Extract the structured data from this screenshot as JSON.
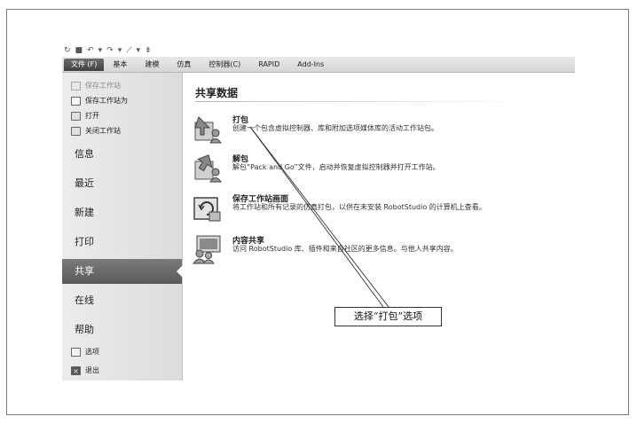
{
  "quick_access": {
    "items": [
      "↻",
      "■",
      "↶",
      "▾",
      "↷",
      "▾",
      "⟋",
      "▾",
      "⇟"
    ]
  },
  "ribbon": {
    "file_tab": "文件 (F)",
    "tabs": [
      "基本",
      "建模",
      "仿真",
      "控制器(C)",
      "RAPID",
      "Add-Ins"
    ]
  },
  "sidebar": {
    "small_top": [
      {
        "label": "保存工作站",
        "icon": "save-icon",
        "disabled": true
      },
      {
        "label": "保存工作站为",
        "icon": "save-as-icon",
        "disabled": false
      },
      {
        "label": "打开",
        "icon": "open-folder-icon",
        "disabled": false
      },
      {
        "label": "关闭工作站",
        "icon": "close-folder-icon",
        "disabled": false
      }
    ],
    "big_items": [
      "信息",
      "最近",
      "新建",
      "打印",
      "共享",
      "在线",
      "帮助"
    ],
    "active_item": "共享",
    "small_bottom": [
      {
        "label": "选项",
        "icon": "options-icon"
      },
      {
        "label": "退出",
        "icon": "exit-icon"
      }
    ]
  },
  "content": {
    "section_title": "共享数据",
    "commands": [
      {
        "title": "打包",
        "desc": "创建一个包含虚拟控制器、库和附加选项媒体库的活动工作站包。",
        "icon": "pack-icon"
      },
      {
        "title": "解包",
        "desc": "解包“Pack and Go”文件，启动并恢复虚拟控制器并打开工作站。",
        "icon": "unpack-icon"
      },
      {
        "title": "保存工作站画面",
        "desc": "将工作站和所有记录的仿真打包，以供在未安装 RobotStudio 的计算机上查看。",
        "icon": "save-screen-icon"
      },
      {
        "title": "内容共享",
        "desc": "访问 RobotStudio 库、插件和来自社区的更多信息。与他人共享内容。",
        "icon": "content-share-icon"
      }
    ]
  },
  "callout": {
    "text": "选择“打包”选项"
  },
  "colors": {
    "active_bg": "#666666",
    "sidebar_bg": "#e4e4e4",
    "ribbon_bg": "#dcdcdc"
  }
}
